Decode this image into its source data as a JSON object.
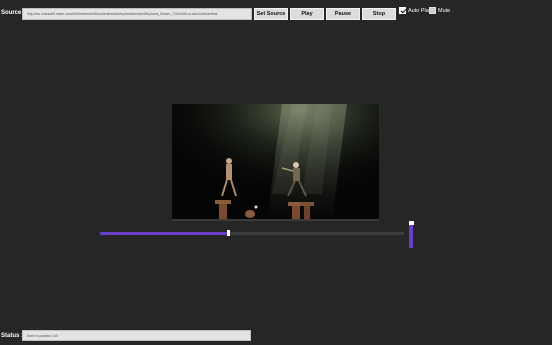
{
  "source": {
    "label": "Source :",
    "url": "http://ars.channel9.msdn.com/ch9/content/ch9/contentmedia/elephantsdream/Stephans_Dream_720x1080-st-aac.ism/manifest"
  },
  "buttons": {
    "set_source": "Set Source",
    "play": "Play",
    "pause": "Pause",
    "stop": "Stop"
  },
  "options": {
    "auto_play": {
      "label": "Auto Play",
      "checked": true
    },
    "mute": {
      "label": "Mute",
      "checked": false
    }
  },
  "progress": {
    "fraction": 0.42
  },
  "volume": {
    "fraction": 1.0
  },
  "status": {
    "label": "Status :",
    "text": "Seek to position 140"
  },
  "colors": {
    "accent": "#6a3fc7",
    "background": "#262626"
  }
}
